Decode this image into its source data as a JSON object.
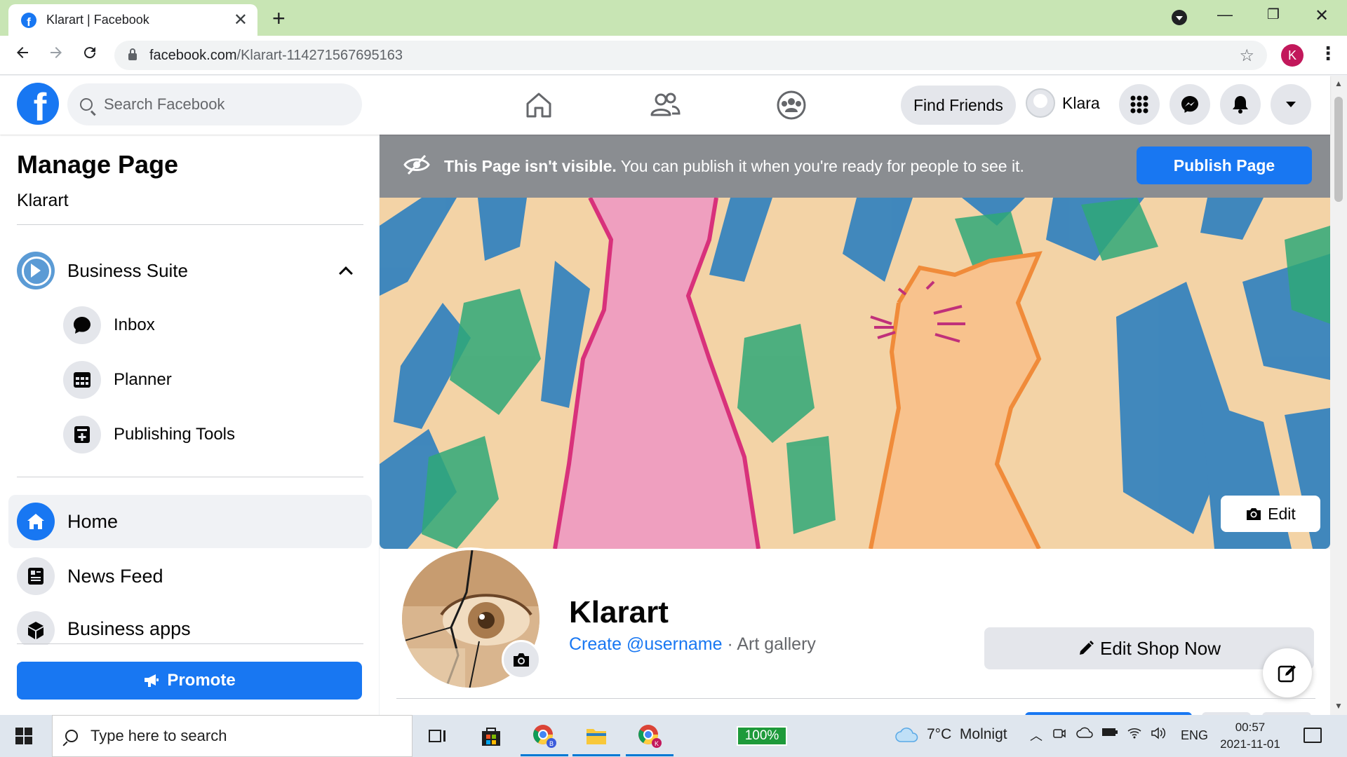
{
  "browser": {
    "tab_title": "Klarart | Facebook",
    "tab_close": "✕",
    "new_tab": "+",
    "url_host": "facebook.com",
    "url_path": "/Klarart-114271567695163",
    "profile_initial": "K"
  },
  "fb_nav": {
    "search_placeholder": "Search Facebook",
    "find_friends": "Find Friends",
    "user_name": "Klara"
  },
  "sidebar": {
    "title": "Manage Page",
    "page_name": "Klarart",
    "business_suite": "Business Suite",
    "sub_items": [
      {
        "label": "Inbox",
        "icon": "message-bubble-icon"
      },
      {
        "label": "Planner",
        "icon": "calendar-grid-icon"
      },
      {
        "label": "Publishing Tools",
        "icon": "publishing-tools-icon"
      }
    ],
    "nav_items": [
      {
        "label": "Home",
        "icon": "home-icon",
        "active": true
      },
      {
        "label": "News Feed",
        "icon": "news-feed-icon"
      },
      {
        "label": "Business apps",
        "icon": "cube-icon"
      }
    ],
    "promote": "Promote"
  },
  "banner": {
    "bold": "This Page isn't visible.",
    "text": " You can publish it when you're ready for people to see it.",
    "publish": "Publish Page"
  },
  "cover": {
    "edit": "Edit"
  },
  "profile": {
    "name": "Klarart",
    "username_link": "Create @username",
    "separator": " · ",
    "category": "Art gallery",
    "edit_shop": "Edit Shop Now"
  },
  "taskbar": {
    "search_placeholder": "Type here to search",
    "battery": "100%",
    "weather": "7°C  Molnigt",
    "lang": "ENG",
    "time": "00:57",
    "date": "2021-11-01"
  },
  "colors": {
    "fb_blue": "#1877f2",
    "banner_gray": "#8a8d91",
    "tab_bar_green": "#c8e5b4"
  }
}
